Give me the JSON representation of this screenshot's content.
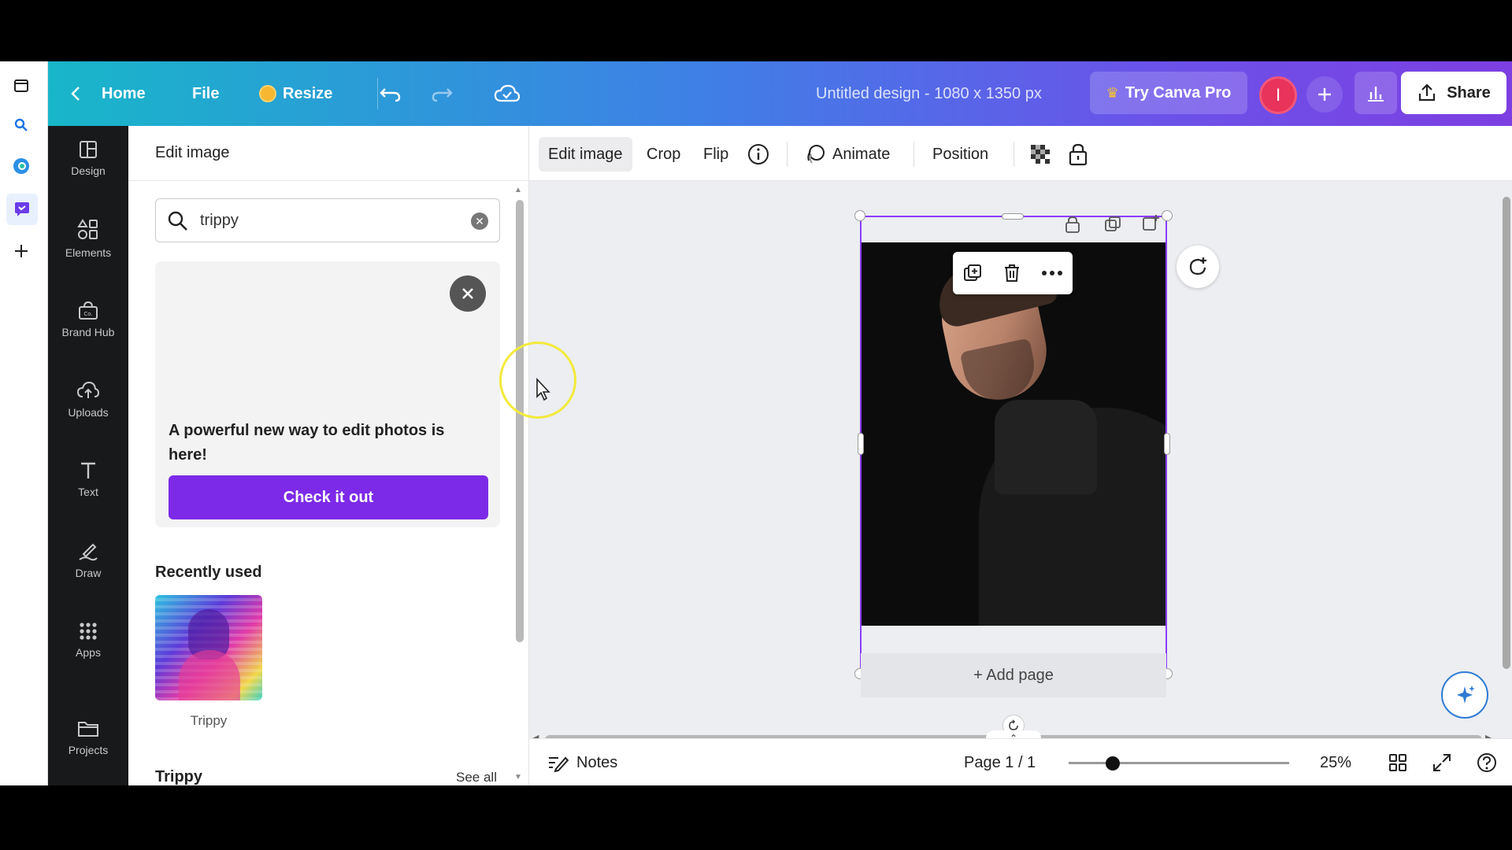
{
  "header": {
    "home_label": "Home",
    "file_label": "File",
    "resize_label": "Resize",
    "design_title": "Untitled design - 1080 x 1350 px",
    "try_pro_label": "Try Canva Pro",
    "avatar_initial": "I",
    "share_label": "Share"
  },
  "rail": {
    "items": [
      {
        "label": "Design",
        "icon": "layout-icon"
      },
      {
        "label": "Elements",
        "icon": "shapes-icon"
      },
      {
        "label": "Brand Hub",
        "icon": "brand-icon"
      },
      {
        "label": "Uploads",
        "icon": "upload-cloud-icon"
      },
      {
        "label": "Text",
        "icon": "text-icon"
      },
      {
        "label": "Draw",
        "icon": "draw-icon"
      },
      {
        "label": "Apps",
        "icon": "apps-grid-icon"
      },
      {
        "label": "Projects",
        "icon": "folder-icon"
      }
    ]
  },
  "panel": {
    "title": "Edit image",
    "search_value": "trippy",
    "promo_text": "A powerful new way to edit photos is here!",
    "promo_button": "Check it out",
    "recently_used_title": "Recently used",
    "recent_item_label": "Trippy",
    "trippy_section_title": "Trippy",
    "see_all_label": "See all"
  },
  "toolbar": {
    "edit_image": "Edit image",
    "crop": "Crop",
    "flip": "Flip",
    "animate": "Animate",
    "position": "Position"
  },
  "canvas": {
    "add_page_label": "+ Add page"
  },
  "footer": {
    "notes_label": "Notes",
    "page_indicator": "Page 1 / 1",
    "zoom_label": "25%",
    "zoom_slider_value": 0.2
  },
  "colors": {
    "accent_purple": "#7d2ae8",
    "selection": "#8b3dff",
    "rail_bg": "#18191b"
  }
}
